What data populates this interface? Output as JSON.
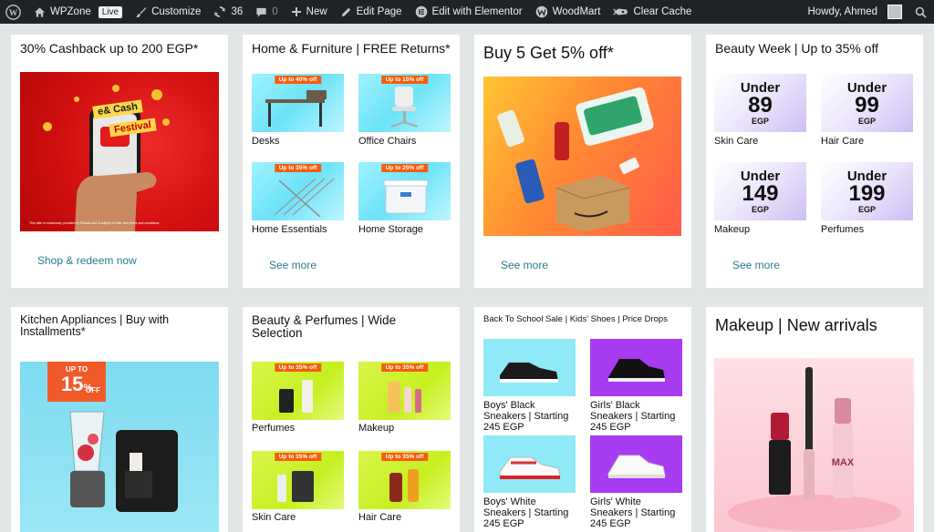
{
  "adminbar": {
    "wp_logo": "wordpress-icon",
    "site_name": "WPZone",
    "live_badge": "Live",
    "customize": "Customize",
    "updates_count": "36",
    "comments_count": "0",
    "new": "New",
    "edit_page": "Edit Page",
    "edit_elementor": "Edit with Elementor",
    "woodmart": "WoodMart",
    "clear_cache": "Clear Cache",
    "howdy": "Howdy, Ahmed"
  },
  "cards": {
    "cashback": {
      "title": "30% Cashback up to 200 EGP*",
      "banner_line1": "e& Cash",
      "banner_line2": "Festival",
      "link": "Shop & redeem now"
    },
    "home": {
      "title": "Home & Furniture | FREE Returns*",
      "tiles": [
        {
          "label": "Desks",
          "badge": "Up to 40% off"
        },
        {
          "label": "Office Chairs",
          "badge": "Up to 15% off"
        },
        {
          "label": "Home Essentials",
          "badge": "Up to 35% off"
        },
        {
          "label": "Home Storage",
          "badge": "Up to 25% off"
        }
      ],
      "link": "See more"
    },
    "buy5": {
      "title": "Buy 5 Get 5% off*",
      "link": "See more"
    },
    "beauty_week": {
      "title": "Beauty Week | Up to 35% off",
      "tiles": [
        {
          "under": "Under",
          "price": "89",
          "currency": "EGP",
          "label": "Skin Care"
        },
        {
          "under": "Under",
          "price": "99",
          "currency": "EGP",
          "label": "Hair Care"
        },
        {
          "under": "Under",
          "price": "149",
          "currency": "EGP",
          "label": "Makeup"
        },
        {
          "under": "Under",
          "price": "199",
          "currency": "EGP",
          "label": "Perfumes"
        }
      ],
      "link": "See more"
    },
    "kitchen": {
      "title": "Kitchen Appliances | Buy with Installments*",
      "badge_line1": "UP TO",
      "badge_line2": "15",
      "badge_line3": "%",
      "badge_line4": "OFF"
    },
    "beauty_perfumes": {
      "title": "Beauty & Perfumes | Wide Selection",
      "tiles": [
        {
          "label": "Perfumes",
          "badge": "Up to 35% off"
        },
        {
          "label": "Makeup",
          "badge": "Up to 35% off"
        },
        {
          "label": "Skin Care",
          "badge": "Up to 35% off"
        },
        {
          "label": "Hair Care",
          "badge": "Up to 35% off"
        }
      ]
    },
    "school": {
      "title": "Back To School Sale | Kids' Shoes | Price Drops",
      "tiles": [
        {
          "label": "Boys' Black Sneakers | Starting 245 EGP"
        },
        {
          "label": "Girls' Black Sneakers | Starting 245 EGP"
        },
        {
          "label": "Boys' White Sneakers | Starting 245 EGP"
        },
        {
          "label": "Girls' White Sneakers | Starting 245 EGP"
        }
      ]
    },
    "makeup": {
      "title": "Makeup | New arrivals"
    }
  }
}
